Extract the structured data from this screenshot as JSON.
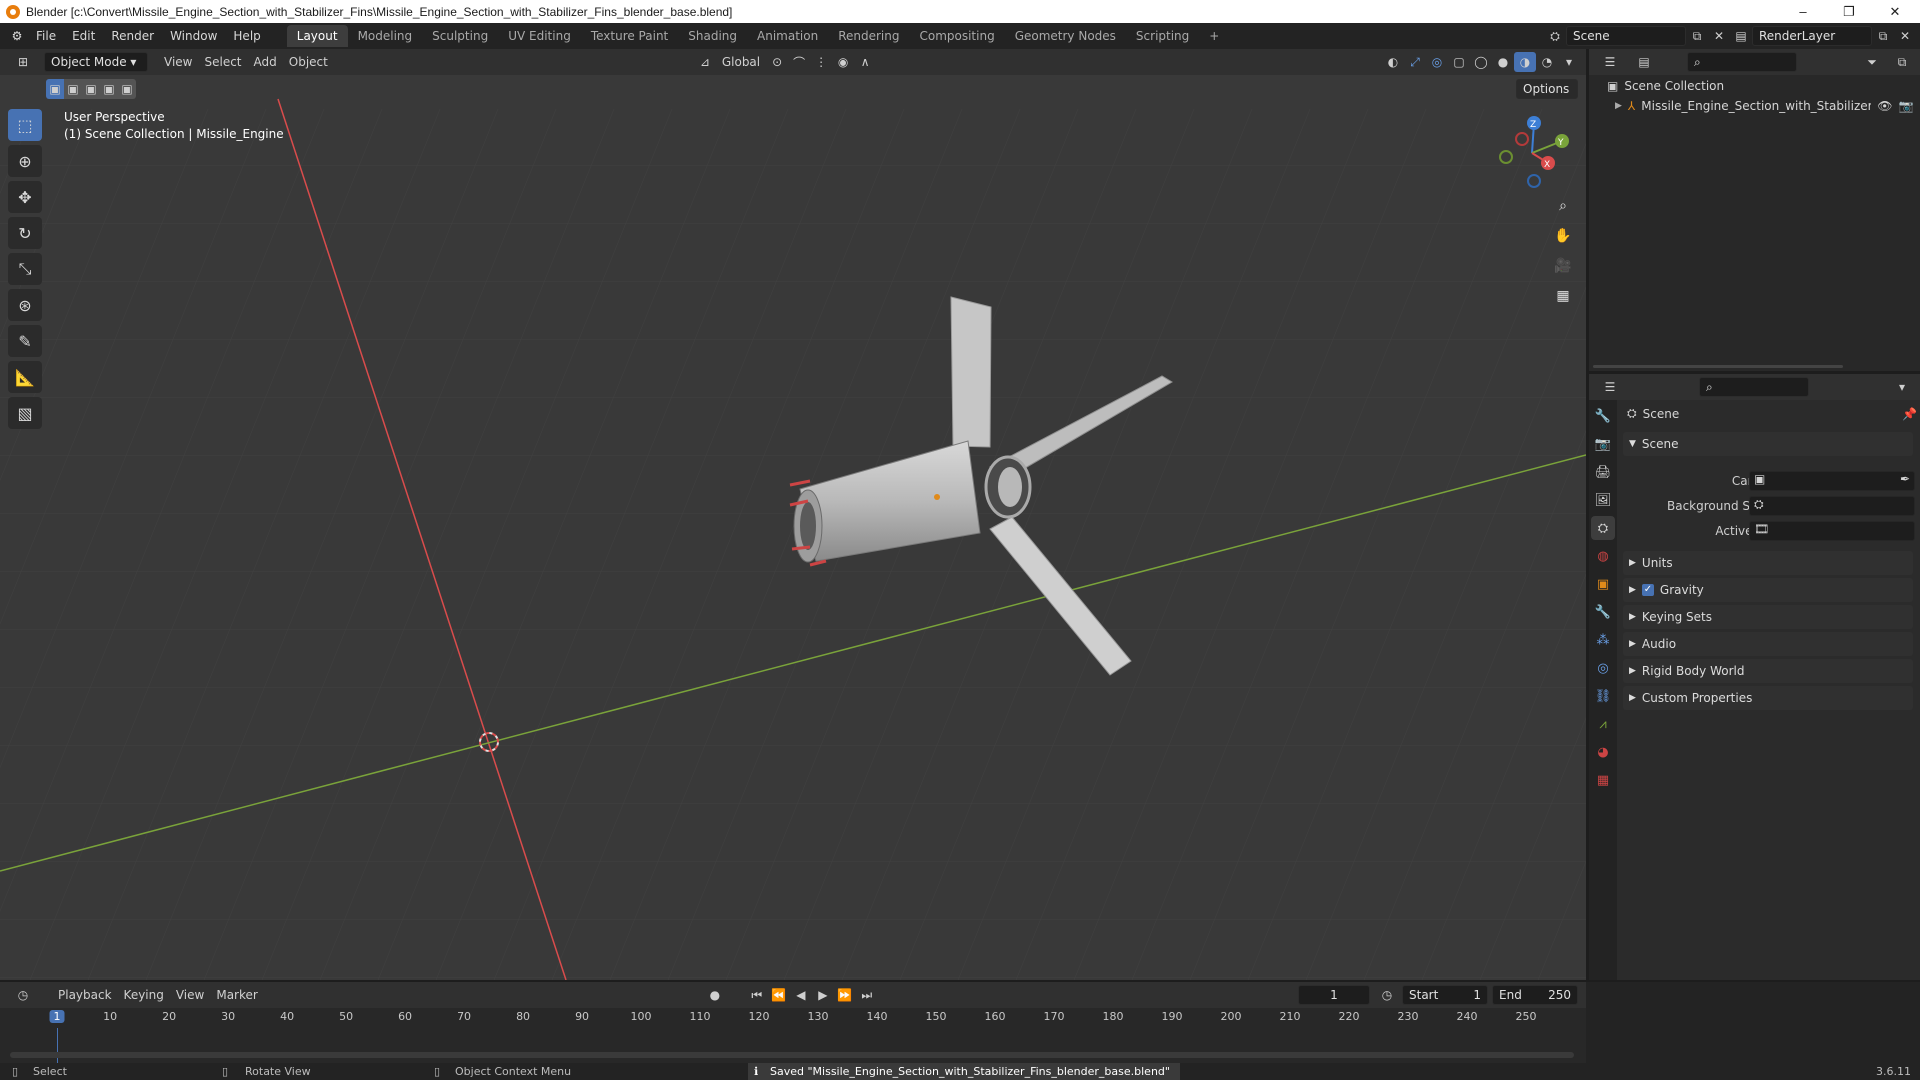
{
  "window": {
    "title": "Blender [c:\\Convert\\Missile_Engine_Section_with_Stabilizer_Fins\\Missile_Engine_Section_with_Stabilizer_Fins_blender_base.blend]",
    "minimize": "–",
    "maximize": "❐",
    "close": "✕"
  },
  "menu": {
    "items": [
      "File",
      "Edit",
      "Render",
      "Window",
      "Help"
    ],
    "workspaces": [
      "Layout",
      "Modeling",
      "Sculpting",
      "UV Editing",
      "Texture Paint",
      "Shading",
      "Animation",
      "Rendering",
      "Compositing",
      "Geometry Nodes",
      "Scripting"
    ],
    "add_tab": "+",
    "scene": "Scene",
    "view_layer": "RenderLayer"
  },
  "viewport": {
    "mode": "Object Mode",
    "menus": [
      "View",
      "Select",
      "Add",
      "Object"
    ],
    "transform": "Global",
    "options": "Options",
    "perspective_label": "User Perspective",
    "collection_label": "(1) Scene Collection | Missile_Engine",
    "axis_x": "X",
    "axis_y": "Y",
    "axis_z": "Z"
  },
  "outliner": {
    "root": "Scene Collection",
    "object": "Missile_Engine_Section_with_Stabilizer_"
  },
  "properties": {
    "context": "Scene",
    "section_scene": "Scene",
    "camera_label": "Camera",
    "background_label": "Background Scene",
    "clip_label": "Active Clip",
    "sections": [
      "Units",
      "Gravity",
      "Keying Sets",
      "Audio",
      "Rigid Body World",
      "Custom Properties"
    ],
    "gravity_checked": true
  },
  "timeline": {
    "menus": [
      "Playback",
      "Keying",
      "View",
      "Marker"
    ],
    "current_frame": "1",
    "start_label": "Start",
    "start": "1",
    "end_label": "End",
    "end": "250",
    "ticks": [
      "1",
      "10",
      "20",
      "30",
      "40",
      "50",
      "60",
      "70",
      "80",
      "90",
      "100",
      "110",
      "120",
      "130",
      "140",
      "150",
      "160",
      "170",
      "180",
      "190",
      "200",
      "210",
      "220",
      "230",
      "240",
      "250"
    ]
  },
  "status": {
    "select": "Select",
    "rotate": "Rotate View",
    "context_menu": "Object Context Menu",
    "message": "Saved \"Missile_Engine_Section_with_Stabilizer_Fins_blender_base.blend\"",
    "version": "3.6.11"
  },
  "colors": {
    "accent": "#4772b3",
    "x_axis": "#d94c4c",
    "y_axis": "#7aa33a",
    "z_axis": "#3d7fd6",
    "viewport_bg": "#393939"
  }
}
